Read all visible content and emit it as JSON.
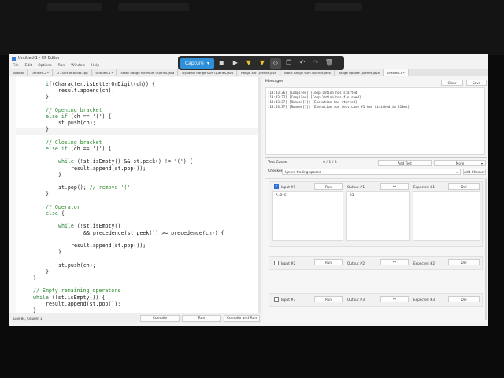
{
  "capture_toolbar": {
    "capture_label": "Capture",
    "icons": [
      "image-icon",
      "video-icon",
      "highlighter-icon",
      "marker-icon",
      "eraser-icon",
      "copy-icon",
      "undo-icon",
      "redo-icon",
      "trash-icon"
    ]
  },
  "window": {
    "title": "Untitled-1 - CP Editor"
  },
  "menu": [
    "File",
    "Edit",
    "Options",
    "Run",
    "Window",
    "Help"
  ],
  "tabs": [
    "Tutorial",
    "Untitled-2 *",
    "D - Sort of Bullet.cpp",
    "Untitled-4 *",
    "Static Range Minimum Queries.java",
    "Dynamic Range Sum Queries.java",
    "Range Xor Queries.java",
    "Static Range Sum Queries.java",
    "Range Update Queries.java",
    "Untitled-1 *"
  ],
  "code": [
    {
      "indent": 8,
      "parts": [
        [
          "kw",
          "if"
        ],
        [
          "",
          "(Character.isLetterOrDigit(ch)) {"
        ]
      ]
    },
    {
      "indent": 12,
      "parts": [
        [
          "",
          "result.append(ch);"
        ]
      ]
    },
    {
      "indent": 8,
      "parts": [
        [
          "",
          "}"
        ]
      ]
    },
    {
      "indent": 0,
      "parts": []
    },
    {
      "indent": 8,
      "parts": [
        [
          "cm",
          "// Opening bracket"
        ]
      ]
    },
    {
      "indent": 8,
      "parts": [
        [
          "kw",
          "else if"
        ],
        [
          "",
          " (ch == '(') {"
        ]
      ]
    },
    {
      "indent": 12,
      "parts": [
        [
          "",
          "st.push(ch);"
        ]
      ]
    },
    {
      "indent": 8,
      "parts": [
        [
          "",
          "}"
        ]
      ]
    },
    {
      "indent": 0,
      "parts": []
    },
    {
      "indent": 8,
      "parts": [
        [
          "cm",
          "// Closing bracket"
        ]
      ]
    },
    {
      "indent": 8,
      "parts": [
        [
          "kw",
          "else if"
        ],
        [
          "",
          " (ch == ')') {"
        ]
      ]
    },
    {
      "indent": 0,
      "parts": []
    },
    {
      "indent": 12,
      "parts": [
        [
          "kw",
          "while"
        ],
        [
          "",
          " (!st.isEmpty() && st.peek() != '(') {"
        ]
      ]
    },
    {
      "indent": 16,
      "parts": [
        [
          "",
          "result.append(st.pop());"
        ]
      ]
    },
    {
      "indent": 12,
      "parts": [
        [
          "",
          "}"
        ]
      ]
    },
    {
      "indent": 0,
      "parts": []
    },
    {
      "indent": 12,
      "parts": [
        [
          "",
          "st.pop(); "
        ],
        [
          "cm",
          "// remove '('"
        ]
      ]
    },
    {
      "indent": 8,
      "parts": [
        [
          "",
          "}"
        ]
      ]
    },
    {
      "indent": 0,
      "parts": []
    },
    {
      "indent": 8,
      "parts": [
        [
          "cm",
          "// Operator"
        ]
      ]
    },
    {
      "indent": 8,
      "parts": [
        [
          "kw",
          "else"
        ],
        [
          "",
          " {"
        ]
      ]
    },
    {
      "indent": 0,
      "parts": []
    },
    {
      "indent": 12,
      "parts": [
        [
          "kw",
          "while"
        ],
        [
          "",
          " (!st.isEmpty()"
        ]
      ]
    },
    {
      "indent": 20,
      "parts": [
        [
          "",
          "&& precedence(st.peek()) >= precedence(ch)) {"
        ]
      ]
    },
    {
      "indent": 0,
      "parts": []
    },
    {
      "indent": 16,
      "parts": [
        [
          "",
          "result.append(st.pop());"
        ]
      ]
    },
    {
      "indent": 12,
      "parts": [
        [
          "",
          "}"
        ]
      ]
    },
    {
      "indent": 0,
      "parts": []
    },
    {
      "indent": 12,
      "parts": [
        [
          "",
          "st.push(ch);"
        ]
      ]
    },
    {
      "indent": 8,
      "parts": [
        [
          "",
          "}"
        ]
      ]
    },
    {
      "indent": 4,
      "parts": [
        [
          "",
          "}"
        ]
      ]
    },
    {
      "indent": 0,
      "parts": []
    },
    {
      "indent": 4,
      "parts": [
        [
          "cm",
          "// Empty remaining operators"
        ]
      ]
    },
    {
      "indent": 4,
      "parts": [
        [
          "kw",
          "while"
        ],
        [
          "",
          " (!st.isEmpty()) {"
        ]
      ]
    },
    {
      "indent": 8,
      "parts": [
        [
          "",
          "result.append(st.pop());"
        ]
      ]
    },
    {
      "indent": 4,
      "parts": [
        [
          "",
          "}"
        ]
      ]
    }
  ],
  "status": {
    "position": "Line 84, Column 1"
  },
  "run_buttons": {
    "compile": "Compile",
    "run": "Run",
    "compile_and_run": "Compile and Run"
  },
  "messages": {
    "title": "Messages",
    "clear": "Clear",
    "save": "Save",
    "lines": [
      "[18:43:36] [Compiler] [Compilation has started]",
      "[18:43:37] [Compiler] [Compilation has finished]",
      "[18:43:37] [Runner[1]] [Execution has started]",
      "[18:43:37] [Runner[1]] [Execution for test case #1 has finished in 219ms]"
    ]
  },
  "tests": {
    "title": "Test Cases",
    "count": "0 / 1 / 3",
    "add_test": "Add Test",
    "more": "More",
    "checker_label": "Checker:",
    "checker_value": "Ignore trailing spaces",
    "add_checker": "Add Checker",
    "cases": [
      {
        "checked": true,
        "input_label": "Input #1",
        "run": "Run",
        "output_label": "Output #1",
        "diff": "**",
        "expected_label": "Expected #1",
        "del": "Del",
        "input": "A+B*C",
        "output": "23",
        "expected": ""
      },
      {
        "checked": false,
        "input_label": "Input #2",
        "run": "Run",
        "output_label": "Output #2",
        "diff": "**",
        "expected_label": "Expected #2",
        "del": "Del"
      },
      {
        "checked": false,
        "input_label": "Input #3",
        "run": "Run",
        "output_label": "Output #3",
        "diff": "**",
        "expected_label": "Expected #3",
        "del": "Del"
      }
    ]
  }
}
